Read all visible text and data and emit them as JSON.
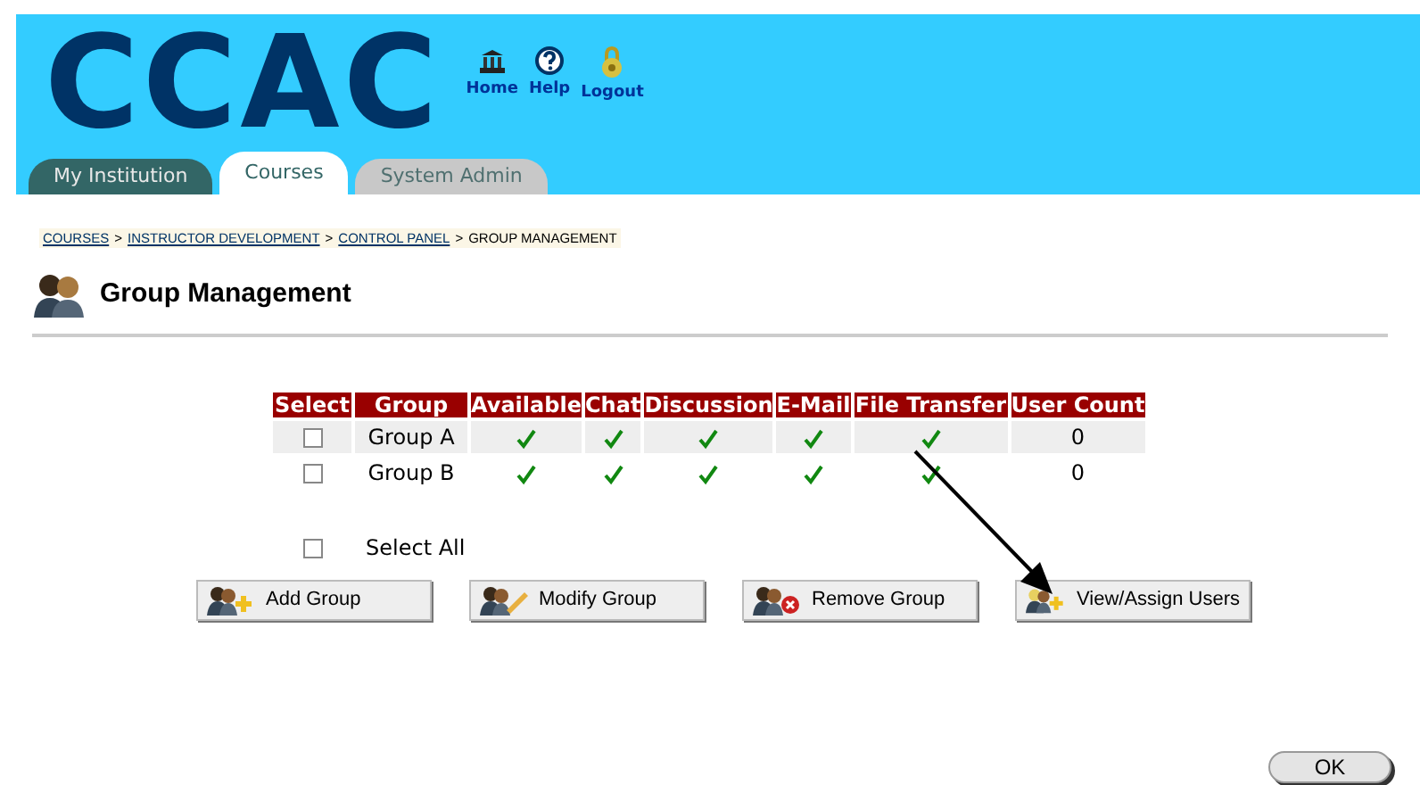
{
  "header": {
    "logo": "CCAC",
    "links": [
      {
        "kind": "home",
        "label": "Home"
      },
      {
        "kind": "help",
        "label": "Help"
      },
      {
        "kind": "logout",
        "label": "Logout"
      }
    ]
  },
  "tabs": [
    {
      "label": "My Institution",
      "kind": "dark",
      "selected": false
    },
    {
      "label": "Courses",
      "kind": "light",
      "selected": true
    },
    {
      "label": "System Admin",
      "kind": "grey",
      "selected": false
    }
  ],
  "breadcrumb": [
    {
      "label": "COURSES",
      "link": true
    },
    {
      "label": "INSTRUCTOR DEVELOPMENT",
      "link": true
    },
    {
      "label": "CONTROL PANEL",
      "link": true
    },
    {
      "label": "GROUP MANAGEMENT",
      "link": false
    }
  ],
  "breadcrumb_separator": ">",
  "page_title": "Group Management",
  "table": {
    "columns": [
      "Select",
      "Group",
      "Available",
      "Chat",
      "Discussion",
      "E-Mail",
      "File Transfer",
      "User Count"
    ],
    "rows": [
      {
        "checked": false,
        "group": "Group A",
        "available": true,
        "chat": true,
        "discussion": true,
        "email": true,
        "file_transfer": true,
        "user_count": "0"
      },
      {
        "checked": false,
        "group": "Group B",
        "available": true,
        "chat": true,
        "discussion": true,
        "email": true,
        "file_transfer": true,
        "user_count": "0"
      }
    ]
  },
  "select_all": {
    "label": "Select All",
    "checked": false
  },
  "buttons": [
    {
      "kind": "add",
      "label": "Add Group"
    },
    {
      "kind": "modify",
      "label": "Modify Group"
    },
    {
      "kind": "remove",
      "label": "Remove Group"
    },
    {
      "kind": "assign",
      "label": "View/Assign Users"
    }
  ],
  "ok_button": "OK"
}
